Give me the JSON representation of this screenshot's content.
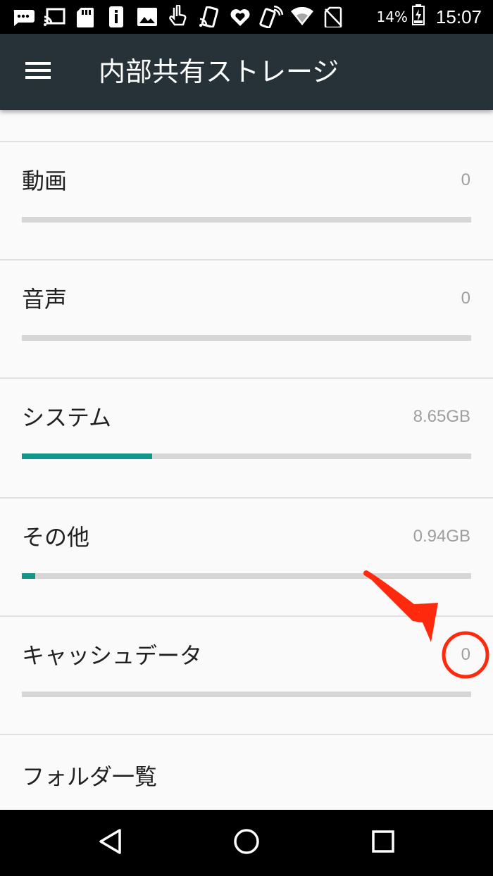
{
  "status_bar": {
    "icons": [
      "chat-bubble-icon",
      "cast-icon",
      "sd-card-icon",
      "phone-info-icon",
      "image-icon",
      "pointing-hand-icon",
      "cast-icon",
      "heart-badge-icon",
      "nfc-phone-icon",
      "wifi-icon",
      "no-sim-icon"
    ],
    "battery": "14%",
    "time": "15:07"
  },
  "app_bar": {
    "title": "内部共有ストレージ",
    "menu_icon": "hamburger-menu-icon",
    "background": "#263238"
  },
  "storage_items": [
    {
      "label": "動画",
      "value": "0",
      "fraction": 0
    },
    {
      "label": "音声",
      "value": "0",
      "fraction": 0
    },
    {
      "label": "システム",
      "value": "8.65GB",
      "fraction": 0.29
    },
    {
      "label": "その他",
      "value": "0.94GB",
      "fraction": 0.03
    },
    {
      "label": "キャッシュデータ",
      "value": "0",
      "fraction": 0
    }
  ],
  "folder_list": {
    "label": "フォルダ一覧"
  },
  "colors": {
    "accent": "#12968a",
    "track": "#d6d6d6",
    "annotation": "#ff2a0d"
  },
  "nav_bar": {
    "icons": [
      "back-icon",
      "home-icon",
      "recents-icon"
    ]
  }
}
